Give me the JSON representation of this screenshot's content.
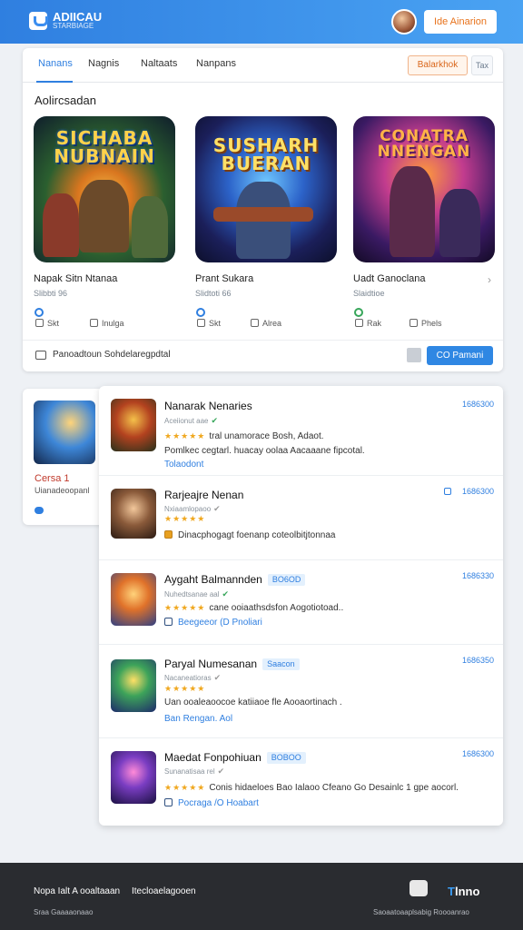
{
  "header": {
    "logo_line1": "ADIICAU",
    "logo_line2": "STARBIAGE",
    "cta_label": "Ide Ainarion"
  },
  "main": {
    "tabs": [
      "Nanans",
      "Nagnis",
      "Naltaats",
      "Nanpans"
    ],
    "btn_orange": "Balarkhok",
    "btn_grey": "Tax",
    "section_title": "Aolircsadan",
    "games": [
      {
        "art_line1": "SICHABA",
        "art_line2": "NUBNAIN",
        "name": "Napak Sitn Ntanaa",
        "sub": "Slibbti 96",
        "act1": "Skt",
        "act2": "Inulga"
      },
      {
        "art_line1": "SUSHARH",
        "art_line2": "BUERAN",
        "name": "Prant Sukara",
        "sub": "Slidtoti 66",
        "act1": "Skt",
        "act2": "Alrea"
      },
      {
        "art_line1": "CONATRA",
        "art_line2": "NNENGAN",
        "name": "Uadt Ganoclana",
        "sub": "Slaidtioe",
        "act1": "Rak",
        "act2": "Phels"
      }
    ],
    "footer_text": "Panoadtoun  Sohdelaregpdtal",
    "footer_button": "CO Pamani"
  },
  "side_card": {
    "title": "Cersa 1",
    "sub": "Uianadeoopanl"
  },
  "list": [
    {
      "title": "Nanarak Nenaries",
      "tag": "",
      "meta": "Aceiionut aae",
      "desc": "tral unamorace  Bosh, Adaot.",
      "desc2": "Pomlkec cegtarl. huacay oolaa Aacaaane fipcotal.",
      "link": "Tolaodont",
      "date": "1686300",
      "stars": "★★★★★"
    },
    {
      "title": "Rarjeajre Nenan",
      "tag": "",
      "meta": "Nxiaamlopaoo",
      "desc": "Dinacphogagt foenanp coteolbitjtonnaa",
      "link": "",
      "date": "1686300",
      "stars": "★★★★★"
    },
    {
      "title": "Aygaht Balmannden",
      "tag": "BO6OD",
      "meta": "Nuhedtsanae aal",
      "desc": "cane ooiaathsdsfon Aogotiotoad..",
      "link": "Beegeeor  (D Pnoliari",
      "date": "1686330",
      "stars": "★★★★★"
    },
    {
      "title": "Paryal Numesanan",
      "tag": "Saacon",
      "meta": "Nacaneatioras",
      "desc": "Uan ooaleaoocoe katiiaoe fle Aooaortinach .",
      "link": "Ban Rengan. Aol",
      "date": "1686350",
      "stars": "★★★★★"
    },
    {
      "title": "Maedat Fonpohiuan",
      "tag": "BOBOO",
      "meta": "Sunanatisaa rel",
      "desc": "Conis hidaeloes Bao Ialaoo Cfeano Go Desainlc 1 gpe aocorl.",
      "link": "Pocraga  /O Hoabart",
      "date": "1686300",
      "stars": "★★★★★"
    }
  ],
  "footer": {
    "link1": "Nopa Ialt A ooaltaaan",
    "link2": "Itecloaelagooen",
    "copyright": "Sraa Gaaaaonaao",
    "right_text": "Saoaatoaaplsabig Roooanrao",
    "brand_pre": "T",
    "brand_rest": "lnno"
  }
}
